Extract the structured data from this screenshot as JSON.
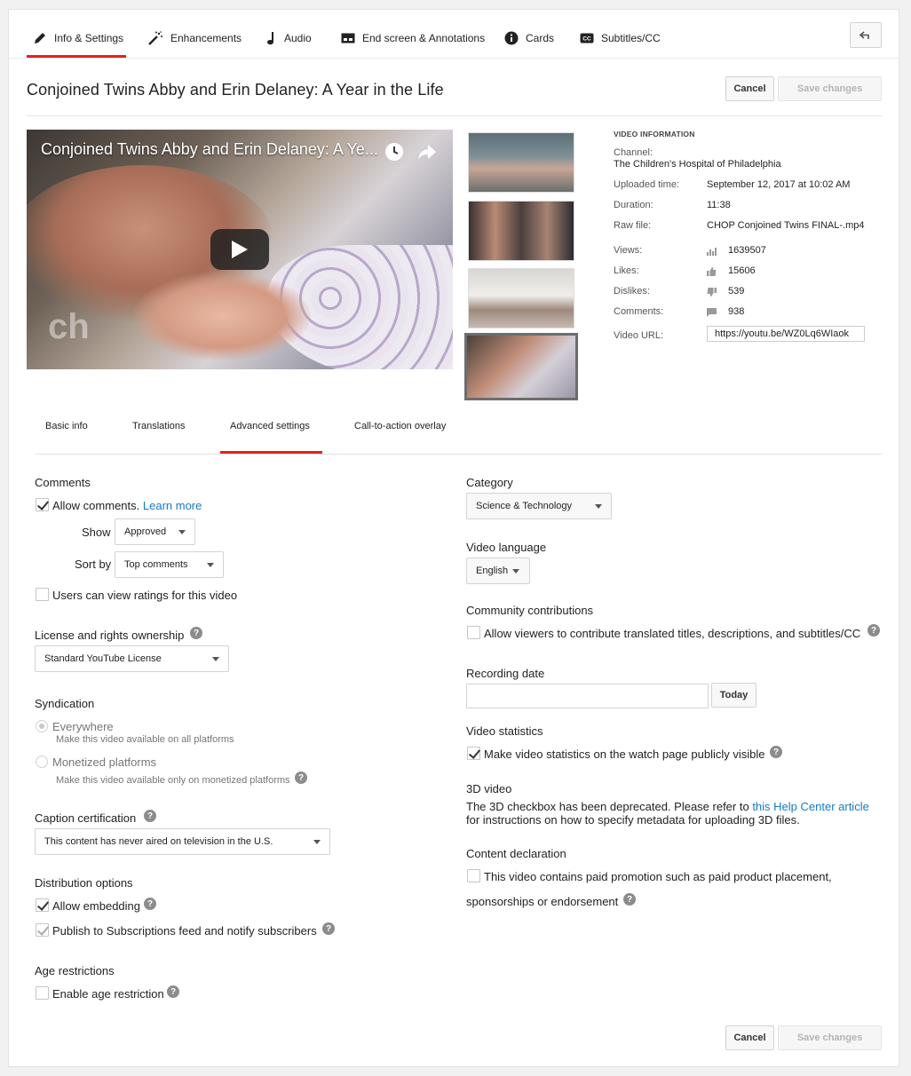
{
  "top_tabs": [
    {
      "label": "Info & Settings",
      "icon": "pencil-icon"
    },
    {
      "label": "Enhancements",
      "icon": "magic-wand-icon"
    },
    {
      "label": "Audio",
      "icon": "music-note-icon"
    },
    {
      "label": "End screen & Annotations",
      "icon": "end-screen-icon"
    },
    {
      "label": "Cards",
      "icon": "info-icon"
    },
    {
      "label": "Subtitles/CC",
      "icon": "cc-icon"
    }
  ],
  "video_title": "Conjoined Twins Abby and Erin Delaney: A Year in the Life",
  "buttons": {
    "cancel": "Cancel",
    "save": "Save changes",
    "today": "Today"
  },
  "player": {
    "overlay_title": "Conjoined Twins Abby and Erin Delaney: A Ye...",
    "logo": "ch"
  },
  "video_info": {
    "heading": "VIDEO INFORMATION",
    "channel_label": "Channel:",
    "channel_value": "The Children's Hospital of Philadelphia",
    "uploaded_label": "Uploaded time:",
    "uploaded_value": "September 12, 2017 at 10:02 AM",
    "duration_label": "Duration:",
    "duration_value": "11:38",
    "raw_label": "Raw file:",
    "raw_value": "CHOP Conjoined Twins FINAL-.mp4",
    "views_label": "Views:",
    "views_value": "1639507",
    "likes_label": "Likes:",
    "likes_value": "15606",
    "dislikes_label": "Dislikes:",
    "dislikes_value": "539",
    "comments_label": "Comments:",
    "comments_value": "938",
    "url_label": "Video URL:",
    "url_value": "https://youtu.be/WZ0Lq6WIaok"
  },
  "sub_tabs": [
    "Basic info",
    "Translations",
    "Advanced settings",
    "Call-to-action overlay"
  ],
  "left": {
    "comments_heading": "Comments",
    "allow_comments": "Allow comments.",
    "learn_more": "Learn more",
    "show_label": "Show",
    "show_value": "Approved",
    "sort_label": "Sort by",
    "sort_value": "Top comments",
    "ratings": "Users can view ratings for this video",
    "license_heading": "License and rights ownership",
    "license_value": "Standard YouTube License",
    "syndication_heading": "Syndication",
    "everywhere": "Everywhere",
    "everywhere_sub": "Make this video available on all platforms",
    "monetized": "Monetized platforms",
    "monetized_sub": "Make this video available only on monetized platforms",
    "caption_heading": "Caption certification",
    "caption_value": "This content has never aired on television in the U.S.",
    "distribution_heading": "Distribution options",
    "allow_embedding": "Allow embedding",
    "publish_subs": "Publish to Subscriptions feed and notify subscribers",
    "age_heading": "Age restrictions",
    "age_enable": "Enable age restriction"
  },
  "right": {
    "category_heading": "Category",
    "category_value": "Science & Technology",
    "language_heading": "Video language",
    "language_value": "English",
    "community_heading": "Community contributions",
    "community_text": "Allow viewers to contribute translated titles, descriptions, and subtitles/CC",
    "recording_heading": "Recording date",
    "recording_value": "",
    "stats_heading": "Video statistics",
    "stats_text": "Make video statistics on the watch page publicly visible",
    "threed_heading": "3D video",
    "threed_text1": "The 3D checkbox has been deprecated. Please refer to ",
    "threed_link": "this Help Center article",
    "threed_text2": "for instructions on how to specify metadata for uploading 3D files.",
    "content_heading": "Content declaration",
    "content_text1": "This video contains paid promotion such as paid product placement,",
    "content_text2": "sponsorships or endorsement"
  },
  "help_glyph": "?",
  "colors": {
    "accent_red": "#e62117",
    "link_blue": "#167ac6"
  }
}
